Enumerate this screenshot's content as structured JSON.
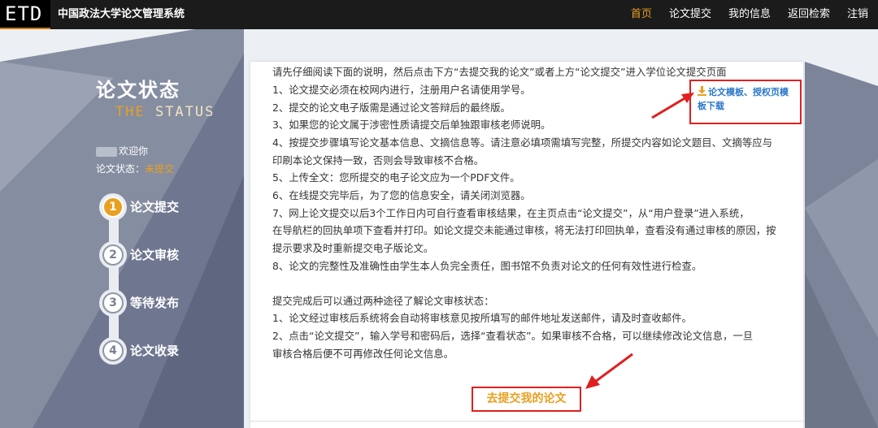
{
  "header": {
    "logo_text": "ETD",
    "site_title": "中国政法大学论文管理系统",
    "nav": [
      {
        "label": "首页",
        "active": true
      },
      {
        "label": "论文提交",
        "active": false
      },
      {
        "label": "我的信息",
        "active": false
      },
      {
        "label": "返回检索",
        "active": false
      },
      {
        "label": "注销",
        "active": false
      }
    ]
  },
  "sidebar": {
    "title": "论文状态",
    "subtitle_part1": "THE",
    "subtitle_part2": " STATUS",
    "welcome": "欢迎你",
    "status_label": "论文状态：",
    "status_value": "未提交",
    "steps": [
      {
        "num": "1",
        "label": "论文提交",
        "active": true
      },
      {
        "num": "2",
        "label": "论文审核",
        "active": false
      },
      {
        "num": "3",
        "label": "等待发布",
        "active": false
      },
      {
        "num": "4",
        "label": "论文收录",
        "active": false
      }
    ]
  },
  "content": {
    "lines": [
      "请先仔细阅读下面的说明，然后点击下方“去提交我的论文”或者上方“论文提交”进入学位论文提交页面",
      "1、论文提交必须在校网内进行，注册用户名请使用学号。",
      "2、提交的论文电子版需是通过论文答辩后的最终版。",
      "3、如果您的论文属于涉密性质请提交后单独跟审核老师说明。",
      "4、按提交步骤填写论文基本信息、文摘信息等。请注意必填项需填写完整，所提交内容如论文题目、文摘等应与",
      "印刷本论文保持一致，否则会导致审核不合格。",
      "5、上传全文：您所提交的电子论文应为一个PDF文件。",
      "6、在线提交完毕后，为了您的信息安全，请关闭浏览器。",
      "7、网上论文提交以后3个工作日内可自行查看审核结果，在主页点击“论文提交”，从“用户登录”进入系统，",
      "在导航栏的回执单项下查看并打印。如论文提交未能通过审核，将无法打印回执单，查看没有通过审核的原因，按",
      "提示要求及时重新提交电子版论文。",
      "8、论文的完整性及准确性由学生本人负完全责任，图书馆不负责对论文的任何有效性进行检查。",
      "提交完成后可以通过两种途径了解论文审核状态：",
      "1、论文经过审核后系统将会自动将审核意见按所填写的邮件地址发送邮件，请及时查收邮件。",
      "2、点击“论文提交”，输入学号和密码后，选择“查看状态”。如果审核不合格，可以继续修改论文信息，一旦",
      "审核合格后便不可再修改任何论文信息。"
    ],
    "download_link": "论文模板、授权页模板下载",
    "submit_link": "去提交我的论文"
  },
  "colors": {
    "accent": "#e8a020",
    "header_bg": "#1b1b1b",
    "annotation_red": "#e02020",
    "link_blue": "#2a77c9"
  }
}
